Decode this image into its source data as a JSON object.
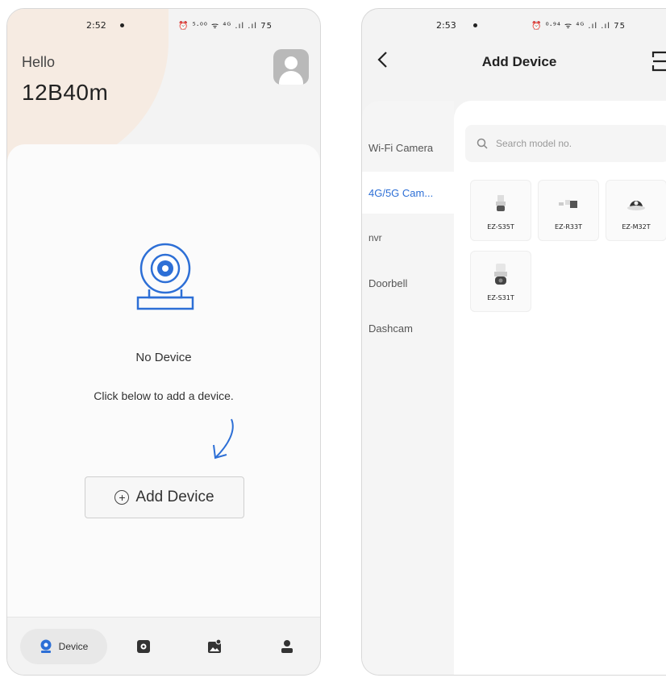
{
  "left_screen": {
    "status": {
      "time": "2:52",
      "icons": "⏰ ⁵·⁰⁰ ᯤ ⁴ᴳ .ıl .ıl 75"
    },
    "greeting": "Hello",
    "username": "12B40m",
    "empty_state": {
      "title": "No Device",
      "hint": "Click below to add a device."
    },
    "add_button_label": "Add Device",
    "tabbar": {
      "device_label": "Device"
    }
  },
  "right_screen": {
    "status": {
      "time": "2:53",
      "icons": "⏰ ⁰·⁹⁴ ᯤ ⁴ᴳ .ıl .ıl 75"
    },
    "title": "Add Device",
    "categories": [
      {
        "label": "Wi-Fi Camera"
      },
      {
        "label": "4G/5G Cam..."
      },
      {
        "label": "nvr"
      },
      {
        "label": "Doorbell"
      },
      {
        "label": "Dashcam"
      }
    ],
    "search": {
      "placeholder": "Search model no."
    },
    "models": [
      {
        "name": "EZ-S35T"
      },
      {
        "name": "EZ-R33T"
      },
      {
        "name": "EZ-M32T"
      },
      {
        "name": "EZ-S31T"
      }
    ]
  },
  "colors": {
    "accent": "#2d6fd6",
    "peach": "#f6ebe2"
  }
}
